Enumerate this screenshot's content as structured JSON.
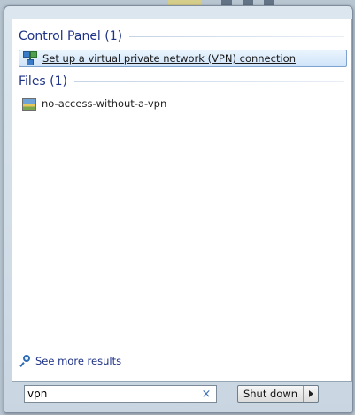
{
  "groups": [
    {
      "header": "Control Panel (1)",
      "items": [
        {
          "label": "Set up a virtual private network (VPN) connection",
          "icon": "network-icon",
          "selected": true
        }
      ]
    },
    {
      "header": "Files (1)",
      "items": [
        {
          "label": "no-access-without-a-vpn",
          "icon": "image-file-icon",
          "selected": false
        }
      ]
    }
  ],
  "see_more": {
    "label": "See more results",
    "icon": "magnifier-icon"
  },
  "search": {
    "value": "vpn",
    "clear_icon": "×"
  },
  "power": {
    "label": "Shut down",
    "arrow_icon": "triangle-right-icon"
  }
}
